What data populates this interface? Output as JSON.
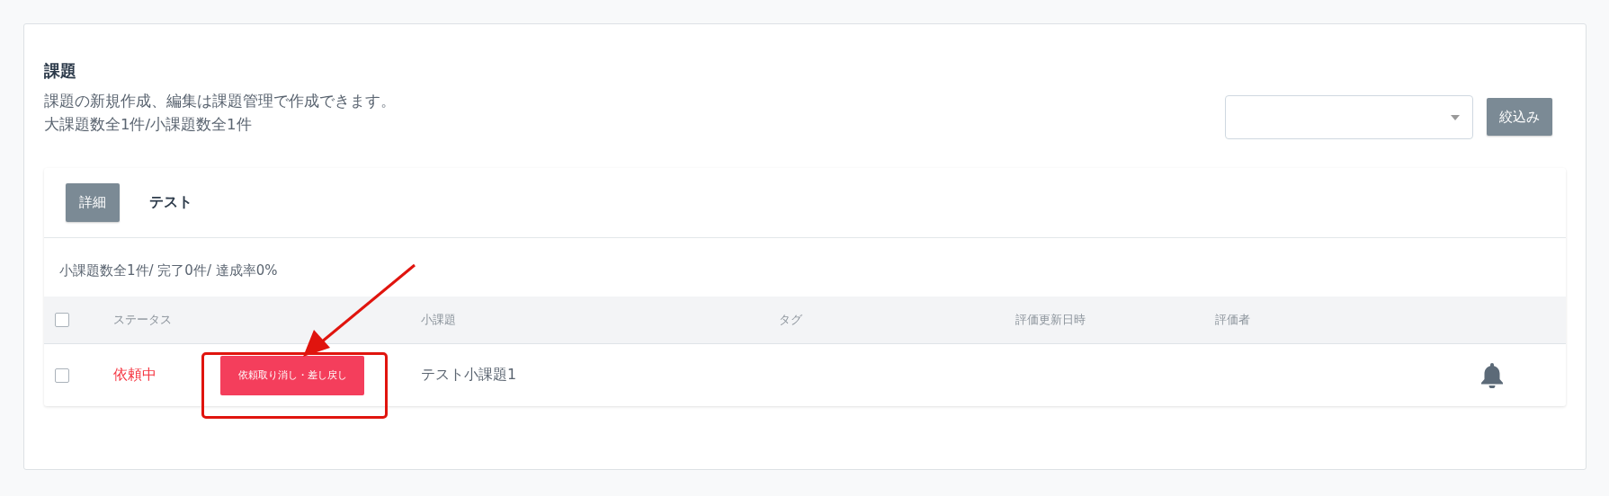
{
  "page": {
    "title": "課題",
    "description": "課題の新規作成、編集は課題管理で作成できます。",
    "counts": "大課題数全1件/小課題数全1件"
  },
  "filter": {
    "button": "絞込み"
  },
  "group": {
    "detail_button": "詳細",
    "name": "テスト",
    "summary": "小課題数全1件/ 完了0件/ 達成率0%",
    "table": {
      "select_all_checked": false,
      "columns": [
        "ステータス",
        "小課題",
        "タグ",
        "評価更新日時",
        "評価者"
      ],
      "rows": [
        {
          "checked": false,
          "status": "依頼中",
          "color": "#f5333f",
          "action": "依頼取り消し・差し戻し",
          "subtask": "テスト小課題1",
          "notification": true
        }
      ]
    }
  }
}
